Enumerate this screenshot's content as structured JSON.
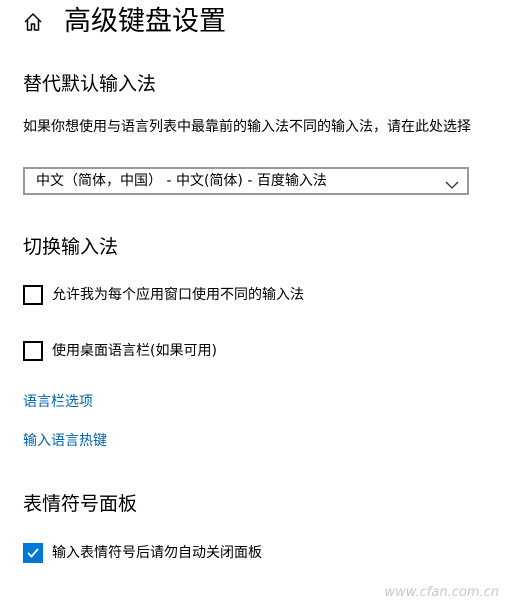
{
  "header": {
    "home_icon": "home-icon",
    "title": "高级键盘设置"
  },
  "default_input": {
    "section_title": "替代默认输入法",
    "description": "如果你想使用与语言列表中最靠前的输入法不同的输入法，请在此处选择",
    "dropdown_value": "中文（简体，中国） - 中文(简体) - 百度输入法",
    "dropdown_icon": "chevron-down-icon"
  },
  "switch_input": {
    "section_title": "切换输入法",
    "options": [
      {
        "label": "允许我为每个应用窗口使用不同的输入法",
        "checked": false
      },
      {
        "label": "使用桌面语言栏(如果可用)",
        "checked": false
      }
    ],
    "links": [
      {
        "label": "语言栏选项"
      },
      {
        "label": "输入语言热键"
      }
    ]
  },
  "emoji_panel": {
    "section_title": "表情符号面板",
    "options": [
      {
        "label": "输入表情符号后请勿自动关闭面板",
        "checked": true
      }
    ]
  },
  "watermark": "www.cfan.com.cn",
  "colors": {
    "accent": "#0078d7",
    "link": "#0063b1",
    "dropdown_border": "#999999",
    "background": "#ffffff"
  }
}
